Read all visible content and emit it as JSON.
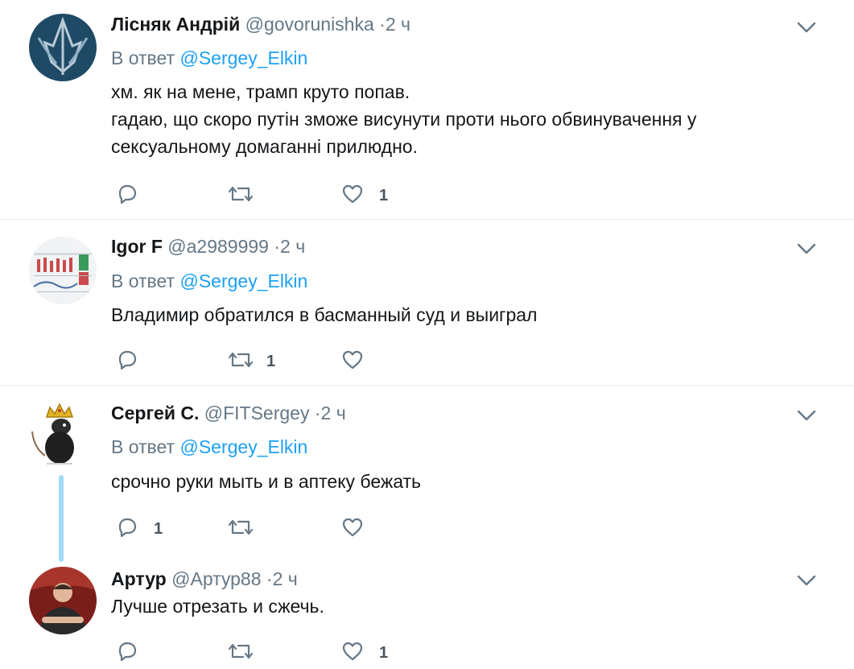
{
  "reply_prefix": "В ответ",
  "tweets": [
    {
      "name": "Лісняк Андрій",
      "handle": "@govorunishka",
      "time": "·2 ч",
      "reply_to": "@Sergey_Elkin",
      "text_lines": [
        "хм. як на мене, трамп круто попав.",
        "гадаю, що скоро путін зможе висунути проти нього обвинувачення у",
        "сексуальному домаганні прилюдно."
      ],
      "reply_count": "",
      "retweet_count": "",
      "like_count": "1"
    },
    {
      "name": "Igor F",
      "handle": "@a2989999",
      "time": "·2 ч",
      "reply_to": "@Sergey_Elkin",
      "text_lines": [
        "Владимир обратился в басманный суд и выиграл"
      ],
      "reply_count": "",
      "retweet_count": "1",
      "like_count": ""
    },
    {
      "name": "Сергей С.",
      "handle": "@FITSergey",
      "time": "·2 ч",
      "reply_to": "@Sergey_Elkin",
      "text_lines": [
        "срочно руки мыть и в аптеку бежать"
      ],
      "reply_count": "1",
      "retweet_count": "",
      "like_count": ""
    },
    {
      "name": "Артур",
      "handle": "@Артур88",
      "time": "·2 ч",
      "reply_to": "",
      "text_lines": [
        "Лучше отрезать и сжечь."
      ],
      "reply_count": "",
      "retweet_count": "",
      "like_count": "1"
    }
  ],
  "colors": {
    "link": "#1da1f2",
    "muted": "#657786",
    "thread": "#a4d9f9"
  },
  "icons": [
    "reply-icon",
    "retweet-icon",
    "like-icon",
    "chevron-down-icon"
  ]
}
